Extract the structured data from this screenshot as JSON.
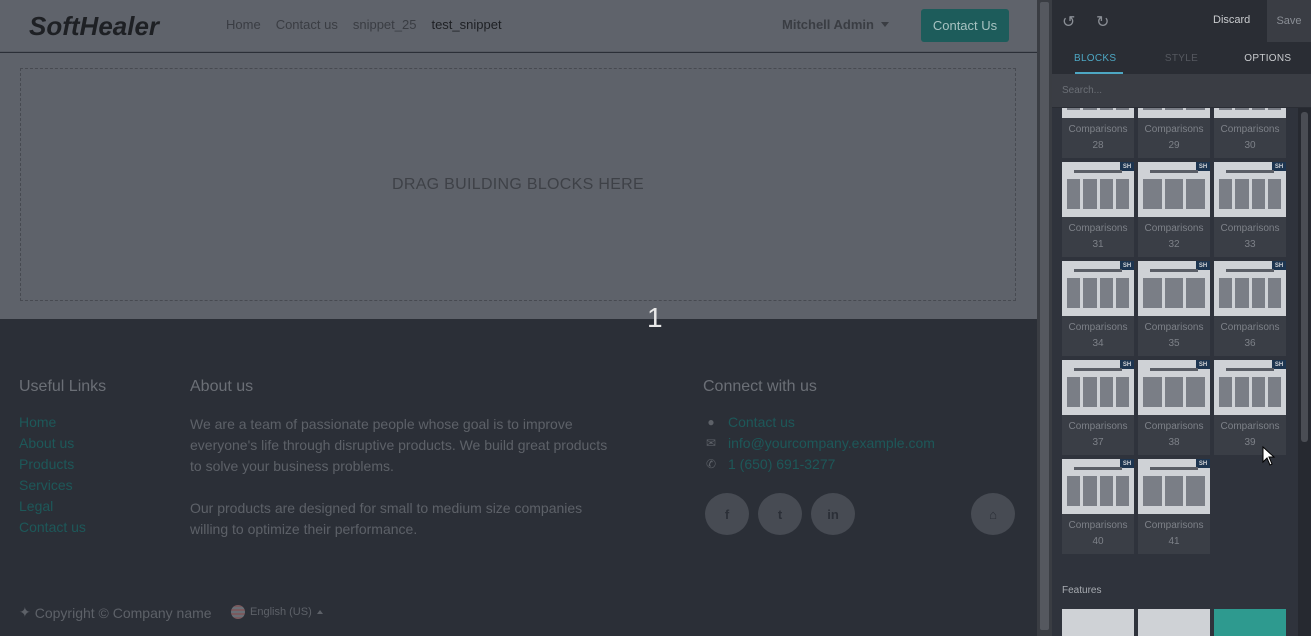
{
  "site": {
    "logo_text": "SoftHealer",
    "nav": [
      "Home",
      "Contact us",
      "snippet_25",
      "test_snippet"
    ],
    "user_name": "Mitchell Admin",
    "contact_button": "Contact Us",
    "dropzone_text": "DRAG BUILDING BLOCKS HERE",
    "page_number": "1"
  },
  "footer": {
    "useful_links_title": "Useful Links",
    "useful_links": [
      "Home",
      "About us",
      "Products",
      "Services",
      "Legal",
      "Contact us"
    ],
    "about_title": "About us",
    "about_p1": "We are a team of passionate people whose goal is to improve everyone's life through disruptive products. We build great products to solve your business problems.",
    "about_p2": "Our products are designed for small to medium size companies willing to optimize their performance.",
    "connect_title": "Connect with us",
    "connect_items": [
      {
        "icon": "comment-icon",
        "text": "Contact us"
      },
      {
        "icon": "envelope-icon",
        "text": "info@yourcompany.example.com"
      },
      {
        "icon": "phone-icon",
        "text": "1 (650) 691-3277"
      }
    ],
    "social": [
      "f",
      "t",
      "in"
    ],
    "copyright": "Copyright © Company name",
    "language": "English (US)"
  },
  "editor": {
    "discard": "Discard",
    "save": "Save",
    "tabs": [
      "BLOCKS",
      "STYLE",
      "OPTIONS"
    ],
    "active_tab": "BLOCKS",
    "search_placeholder": "Search...",
    "blocks": [
      {
        "label": "Comparisons 28"
      },
      {
        "label": "Comparisons 29"
      },
      {
        "label": "Comparisons 30"
      },
      {
        "label": "Comparisons 31"
      },
      {
        "label": "Comparisons 32"
      },
      {
        "label": "Comparisons 33"
      },
      {
        "label": "Comparisons 34"
      },
      {
        "label": "Comparisons 35"
      },
      {
        "label": "Comparisons 36"
      },
      {
        "label": "Comparisons 37"
      },
      {
        "label": "Comparisons 38"
      },
      {
        "label": "Comparisons 39"
      },
      {
        "label": "Comparisons 40"
      },
      {
        "label": "Comparisons 41"
      }
    ],
    "next_section": "Features",
    "badge": "SH",
    "accent_color": "#4da7c3"
  }
}
